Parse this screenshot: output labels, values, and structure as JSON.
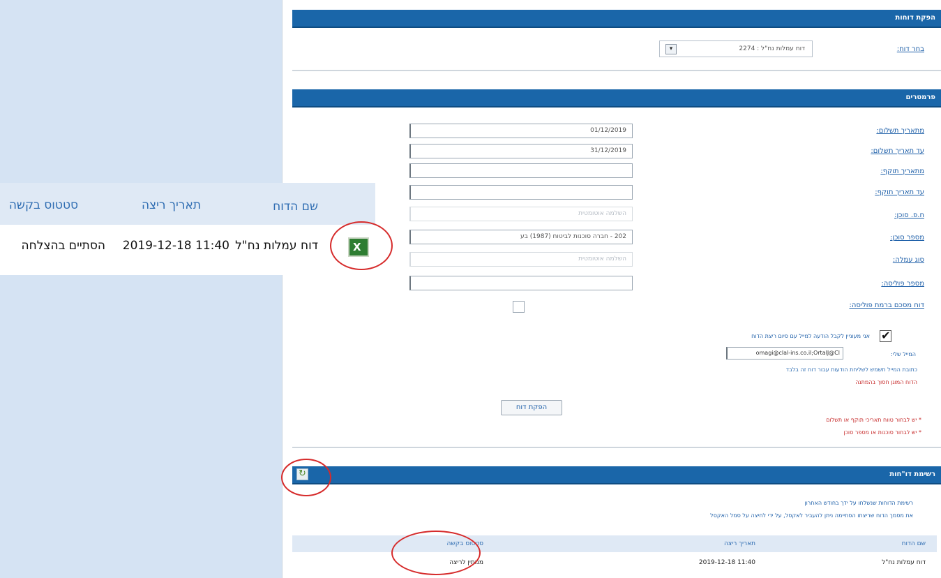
{
  "report_section": {
    "bar_title": "הפקת דוחות",
    "select_label": "בחר דוח:",
    "select_value": "דוח עמלות נח\"ל : 2274",
    "chevron_glyph": "▾"
  },
  "params_section": {
    "bar_title": "פרמטרים",
    "fields": [
      {
        "label": "מתאריך תשלום:",
        "value": "01/12/2019"
      },
      {
        "label": "עד תאריך תשלום:",
        "value": "31/12/2019"
      },
      {
        "label": "מתאריך תוקף:",
        "value": ""
      },
      {
        "label": "עד תאריך תוקף:",
        "value": ""
      },
      {
        "label": "ח.פ. סוכן:",
        "value": "השלמה אוטומטית"
      },
      {
        "label": "מספר סוכן:",
        "value": "202 - חברה סוכנות לביטוח (1987) בע"
      },
      {
        "label": "סוג עמלה:",
        "value": "השלמה אוטומטית"
      },
      {
        "label": "מספר פוליסה:",
        "value": ""
      },
      {
        "label": "דוח מסכם ברמת פוליסה:",
        "value": ""
      }
    ],
    "email_consent": "אני מעוניין לקבל הודעה למייל עם סיום ריצת הדוח",
    "email_label": "המייל שלי:",
    "email_value": "omagi@clal-ins.co.il;OrtalJ@Cl",
    "email_note": "כתובת המייל תשמש לשליחת הודעות עבור דוח זה בלבד",
    "email_warning": "הדוח המוגן חסוך בהמתנה",
    "produce_button": "הפקת דוח",
    "note_1": "* יש לבחור טווח תאריכי תוקף או תשלום",
    "note_2": "* יש לבחור סוכנות או מספר סוכן"
  },
  "reports_section": {
    "bar_title": "רשימת דו\"חות",
    "refresh_icon": "↻",
    "desc_1": "רשימת הדוחות שנשלחו על ידך בחודש האחרון",
    "desc_2": "את מסמך הדוח שריצתו הסתיימה ניתן להעביר לאקסל, על ידי לחיצה על סמל האקסל",
    "columns": {
      "name": "שם הדוח",
      "date": "תאריך ריצה",
      "status": "סטטוס בקשה"
    },
    "row": {
      "name": "דוח עמלות נח\"ל",
      "date": "11:40 2019-12-18",
      "status": "ממתין לריצה"
    }
  },
  "zoomed_table": {
    "columns": {
      "name": "שם הדוח",
      "date": "תאריך ריצה",
      "status": "סטטוס בקשה"
    },
    "row": {
      "name": "דוח עמלות נח\"ל",
      "date": "11:40 2019-12-18",
      "status": "הסתיים בהצלחה"
    },
    "excel_glyph": "X"
  },
  "colors": {
    "bar_blue": "#1a66a9",
    "link_blue": "#1c5ea8",
    "warning_red": "#c62828",
    "annotation_red": "#d62b2b",
    "page_background": "#d5e3f3"
  }
}
